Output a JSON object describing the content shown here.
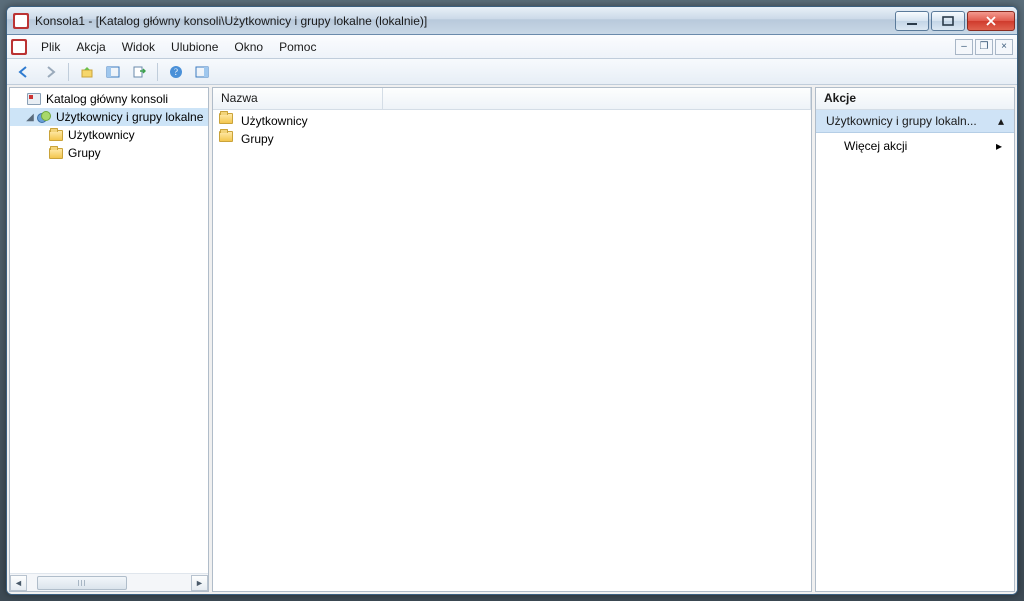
{
  "window": {
    "title": "Konsola1 - [Katalog główny konsoli\\Użytkownicy i grupy lokalne (lokalnie)]"
  },
  "menu": {
    "file": "Plik",
    "action": "Akcja",
    "view": "Widok",
    "favorites": "Ulubione",
    "window": "Okno",
    "help": "Pomoc"
  },
  "tree": {
    "root": "Katalog główny konsoli",
    "node_users_groups": "Użytkownicy i grupy lokalne",
    "node_users": "Użytkownicy",
    "node_groups": "Grupy"
  },
  "list": {
    "column_name": "Nazwa",
    "rows": {
      "users": "Użytkownicy",
      "groups": "Grupy"
    }
  },
  "actions": {
    "header": "Akcje",
    "group": "Użytkownicy i grupy lokaln...",
    "more": "Więcej akcji"
  }
}
